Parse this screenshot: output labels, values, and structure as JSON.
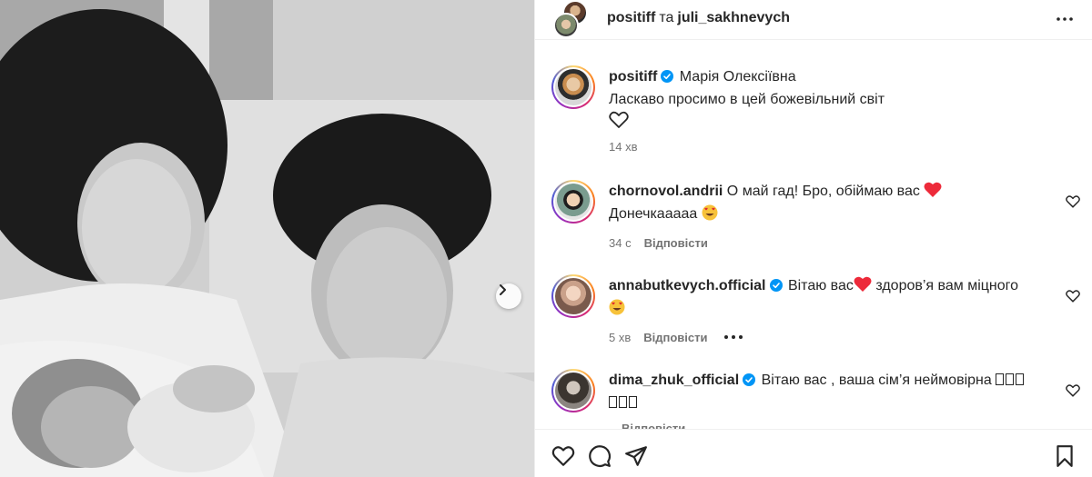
{
  "post": {
    "image_next_icon": "chevron-right-icon"
  },
  "header": {
    "user1": "positiff",
    "separator": "та",
    "user2": "juli_sakhnevych",
    "more_icon": "more-horizontal-icon"
  },
  "caption": {
    "username": "positiff",
    "title": "Марія Олексіївна",
    "text": "Ласкаво просимо в цей божевільний світ",
    "time": "14 хв"
  },
  "comments": [
    {
      "username": "chornovol.andrii",
      "text": "О май гад! Бро, обіймаю вас",
      "text2": "Донечкааааа",
      "time": "34 с",
      "reply": "Відповісти",
      "verified": false
    },
    {
      "username": "annabutkevych.official",
      "text": "Вітаю вас",
      "text_after": "здоров’я вам міцного",
      "time": "5 хв",
      "reply": "Відповісти",
      "verified": true
    },
    {
      "username": "dima_zhuk_official",
      "text": "Вітаю вас , ваша сім’я неймовірна",
      "time": "",
      "reply": "Відповісти",
      "verified": true
    }
  ],
  "actions": {
    "like_icon": "heart-icon",
    "comment_icon": "comment-icon",
    "share_icon": "send-icon",
    "save_icon": "bookmark-icon"
  },
  "colors": {
    "verified": "#0095f6",
    "heart": "#ed2a3a",
    "border": "#efefef",
    "muted": "#737373"
  }
}
